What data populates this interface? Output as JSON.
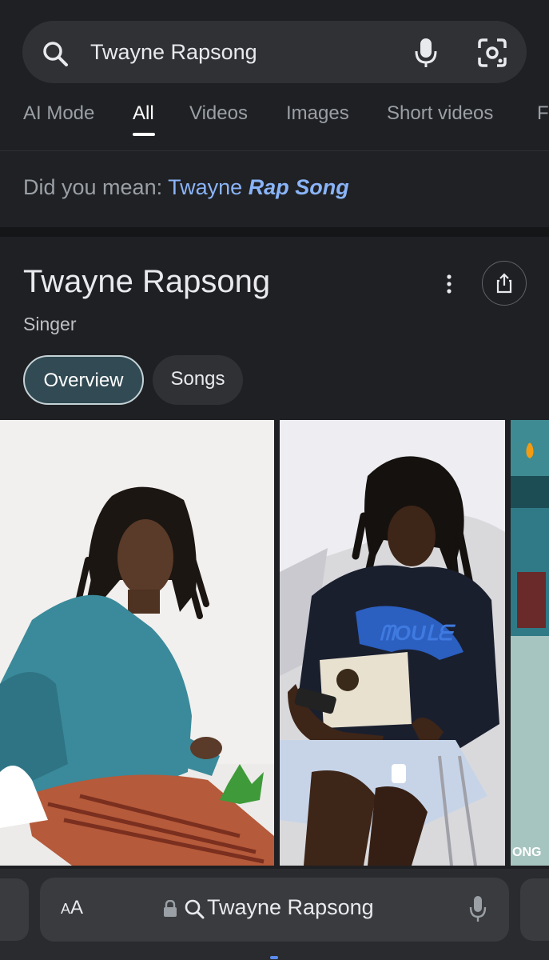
{
  "search": {
    "query": "Twayne Rapsong"
  },
  "tabs": [
    {
      "label": "AI Mode"
    },
    {
      "label": "All"
    },
    {
      "label": "Videos"
    },
    {
      "label": "Images"
    },
    {
      "label": "Short videos"
    },
    {
      "label": "Fo"
    }
  ],
  "did_you_mean": {
    "prefix": "Did you mean:",
    "plain": "Twayne",
    "emphasis": "Rap Song"
  },
  "knowledge_panel": {
    "title": "Twayne Rapsong",
    "subtitle": "Singer",
    "chips": [
      {
        "label": "Overview"
      },
      {
        "label": "Songs"
      }
    ]
  },
  "browser": {
    "aa_label_small": "A",
    "aa_label_large": "A",
    "url_text": "Twayne Rapsong"
  },
  "colors": {
    "background": "#1f2023",
    "link": "#8ab4f8",
    "chip_active": "#314a53"
  },
  "icons": {
    "search": "search-icon",
    "mic": "mic-icon",
    "lens": "google-lens-icon",
    "more": "more-vert-icon",
    "share": "share-icon",
    "lock": "lock-icon"
  }
}
